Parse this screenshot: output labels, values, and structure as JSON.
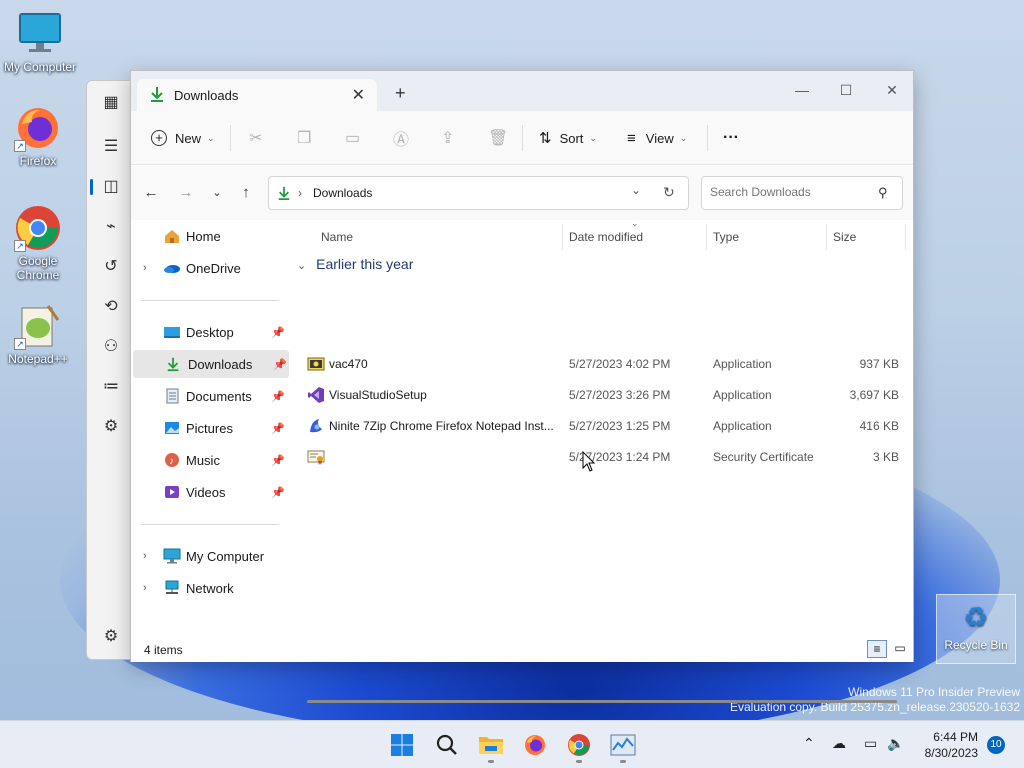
{
  "desktop": {
    "icons": [
      {
        "label": "My Computer"
      },
      {
        "label": "Firefox"
      },
      {
        "label": "Google Chrome"
      },
      {
        "label": "Notepad++"
      }
    ],
    "recycle_bin": "Recycle Bin",
    "watermark": {
      "line1": "Windows 11 Pro Insider Preview",
      "line2": "Evaluation copy. Build 25375.zn_release.230520-1632"
    }
  },
  "explorer": {
    "tab": {
      "title": "Downloads",
      "close": "✕",
      "new": "+"
    },
    "window_controls": {
      "minimize": "—",
      "maximize": "☐",
      "close": "✕"
    },
    "toolbar": {
      "new_label": "New",
      "sort_label": "Sort",
      "view_label": "View",
      "more_label": "···"
    },
    "address": {
      "path": "Downloads",
      "separator": "›"
    },
    "search": {
      "placeholder": "Search Downloads"
    },
    "nav": {
      "home": "Home",
      "onedrive": "OneDrive",
      "quick": [
        {
          "label": "Desktop"
        },
        {
          "label": "Downloads"
        },
        {
          "label": "Documents"
        },
        {
          "label": "Pictures"
        },
        {
          "label": "Music"
        },
        {
          "label": "Videos"
        }
      ],
      "my_computer": "My Computer",
      "network": "Network"
    },
    "columns": {
      "name": "Name",
      "date": "Date modified",
      "type": "Type",
      "size": "Size"
    },
    "group_label": "Earlier this year",
    "files": [
      {
        "name": "vac470",
        "date": "5/27/2023 4:02 PM",
        "type": "Application",
        "size": "937 KB"
      },
      {
        "name": "VisualStudioSetup",
        "date": "5/27/2023 3:26 PM",
        "type": "Application",
        "size": "3,697 KB"
      },
      {
        "name": "Ninite 7Zip Chrome Firefox Notepad Inst...",
        "date": "5/27/2023 1:25 PM",
        "type": "Application",
        "size": "416 KB"
      },
      {
        "name": "",
        "date": "5/27/2023 1:24 PM",
        "type": "Security Certificate",
        "size": "3 KB"
      }
    ],
    "status": {
      "count": "4 items"
    }
  },
  "taskbar": {
    "clock_time": "6:44 PM",
    "clock_date": "8/30/2023",
    "notification_count": "10"
  },
  "colors": {
    "accent": "#0067c0",
    "download_green": "#1f9b3a"
  }
}
